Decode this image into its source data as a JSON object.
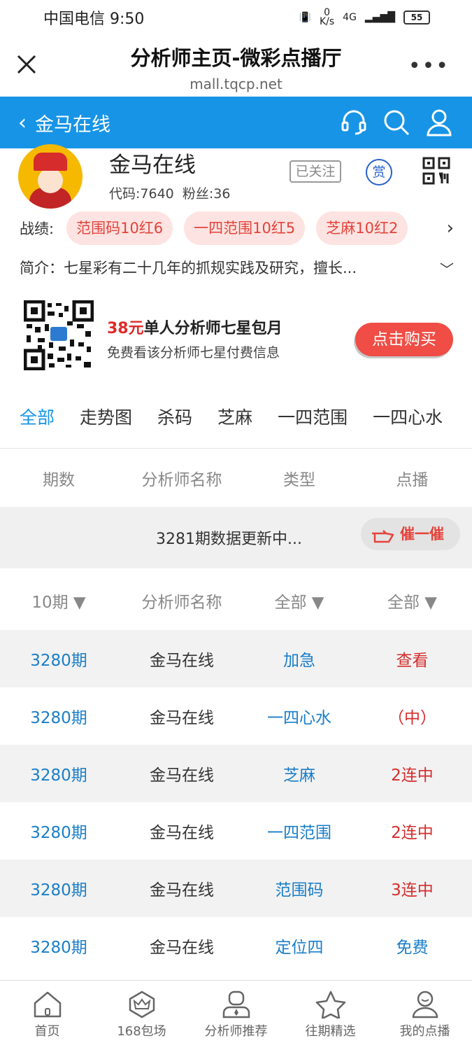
{
  "status": {
    "carrier_time": "中国电信 9:50",
    "net_speed_value": "0",
    "net_speed_unit": "K/s",
    "network": "4G",
    "battery": "55"
  },
  "browser": {
    "title": "分析师主页-微彩点播厅",
    "url": "mall.tqcp.net"
  },
  "header": {
    "back_title": "金马在线"
  },
  "profile": {
    "name": "金马在线",
    "code": "代码:7640",
    "fans": "粉丝:36",
    "follow_label": "已关注",
    "reward_label": "赏"
  },
  "record": {
    "label": "战绩:",
    "chips": [
      "范围码10红6",
      "一四范围10红5",
      "芝麻10红2"
    ]
  },
  "intro": {
    "text": "简介：七星彩有二十几年的抓规实践及研究，擅长..."
  },
  "promo": {
    "price": "38元",
    "title_rest": "单人分析师七星包月",
    "subtitle": "免费看该分析师七星付费信息",
    "buy_label": "点击购买"
  },
  "tabs": [
    "全部",
    "走势图",
    "杀码",
    "芝麻",
    "一四范围",
    "一四心水"
  ],
  "table_header": [
    "期数",
    "分析师名称",
    "类型",
    "点播"
  ],
  "updating": {
    "message": "3281期数据更新中...",
    "urge_label": "催一催"
  },
  "filters": [
    "10期 ▼",
    "分析师名称",
    "全部 ▼",
    "全部 ▼"
  ],
  "rows": [
    {
      "period": "3280期",
      "analyst": "金马在线",
      "type": "加急",
      "action": "查看"
    },
    {
      "period": "3280期",
      "analyst": "金马在线",
      "type": "一四心水",
      "action": "（中）"
    },
    {
      "period": "3280期",
      "analyst": "金马在线",
      "type": "芝麻",
      "action": "2连中"
    },
    {
      "period": "3280期",
      "analyst": "金马在线",
      "type": "一四范围",
      "action": "2连中"
    },
    {
      "period": "3280期",
      "analyst": "金马在线",
      "type": "范围码",
      "action": "3连中"
    },
    {
      "period": "3280期",
      "analyst": "金马在线",
      "type": "定位四",
      "action": "免费"
    }
  ],
  "nav": [
    "首页",
    "168包场",
    "分析师推荐",
    "往期精选",
    "我的点播"
  ],
  "colors": {
    "brand_blue": "#1794e6",
    "red": "#ef4d45",
    "link_blue": "#1a7ec8"
  }
}
